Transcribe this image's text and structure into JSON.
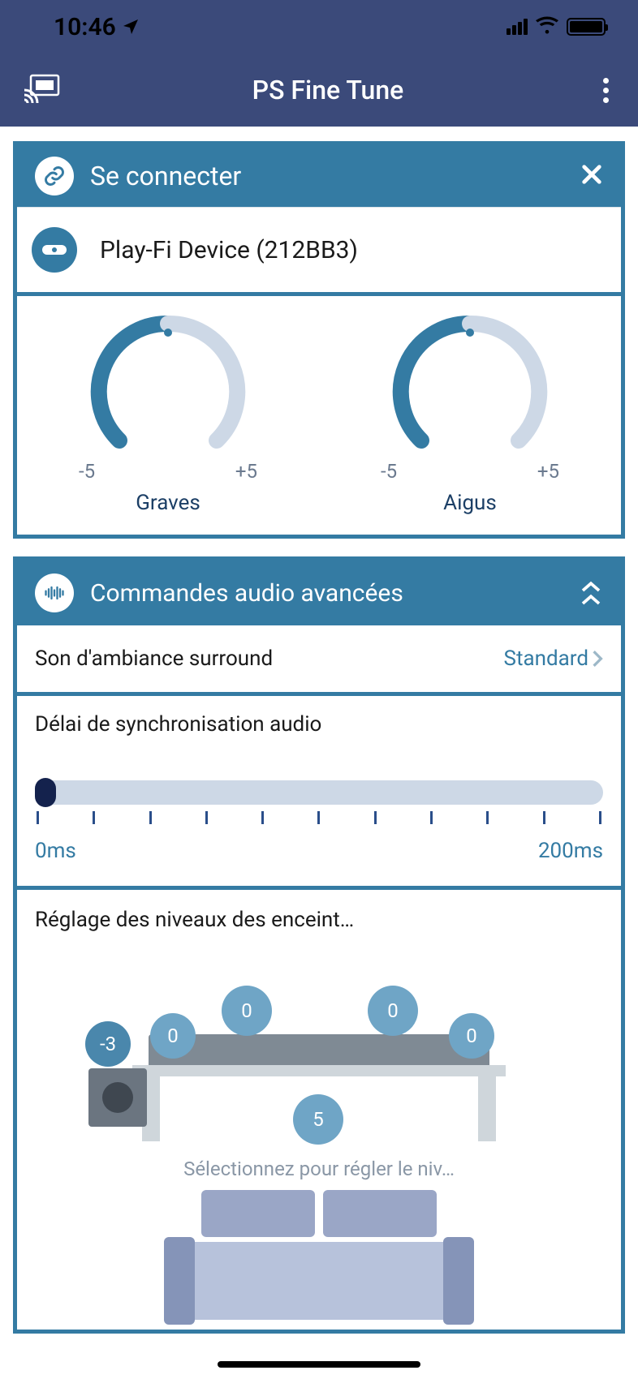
{
  "status": {
    "time": "10:46"
  },
  "nav": {
    "title": "PS Fine Tune"
  },
  "connect": {
    "header": "Se connecter",
    "device": "Play-Fi Device (212BB3)"
  },
  "dials": {
    "bass": {
      "min": "-5",
      "max": "+5",
      "label": "Graves"
    },
    "treble": {
      "min": "-5",
      "max": "+5",
      "label": "Aigus"
    }
  },
  "advanced": {
    "header": "Commandes audio avancées",
    "surround": {
      "label": "Son d'ambiance surround",
      "value": "Standard"
    },
    "sync": {
      "label": "Délai de synchronisation audio",
      "min": "0ms",
      "max": "200ms"
    },
    "speakers": {
      "label": "Réglage des niveaux des enceint…",
      "hint": "Sélectionnez pour régler le niv…",
      "sub": "-3",
      "left_front": "0",
      "center_left": "0",
      "center_right": "0",
      "right_front": "0",
      "center": "5"
    }
  }
}
